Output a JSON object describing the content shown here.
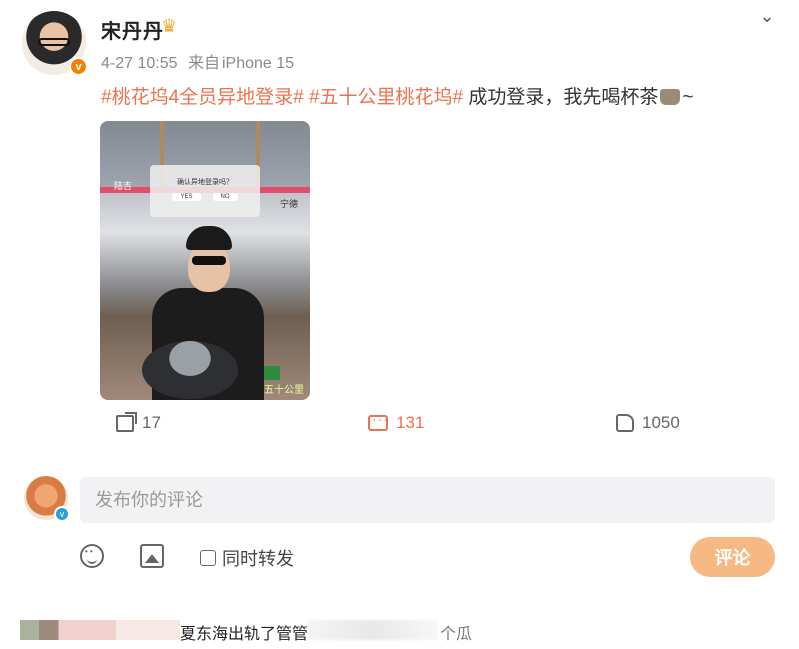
{
  "post": {
    "username": "宋丹丹",
    "verified_badge": "v",
    "date": "4-27 10:55",
    "source_prefix": "来自",
    "source_device": "iPhone 15",
    "tag1": "#桃花坞4全员异地登录#",
    "tag2": "#五十公里桃花坞#",
    "text": "成功登录，我先喝杯茶",
    "text_suffix": "~",
    "photo": {
      "dialog_title": "确认异地登录吗？",
      "yes_label": "YES",
      "no_label": "NO",
      "left_tag": "陆吉",
      "right_tag": "宁德",
      "logo_text": "五十公里"
    }
  },
  "actions": {
    "share_count": "17",
    "comment_count": "131",
    "like_count": "1050"
  },
  "compose": {
    "placeholder": "发布你的评论",
    "repost_label": "同时转发",
    "submit_label": "评论"
  },
  "bottom": {
    "comment_text": "夏东海出轨了管管",
    "comment_text_2": "个瓜"
  },
  "colors": {
    "accent": "#eb7350",
    "submit_bg": "#f7b983",
    "input_bg": "#f2f2f4"
  },
  "icons": [
    "chevron-down-icon",
    "share-icon",
    "comment-icon",
    "like-icon",
    "emoji-icon",
    "image-icon",
    "crown-icon",
    "tea-icon"
  ]
}
